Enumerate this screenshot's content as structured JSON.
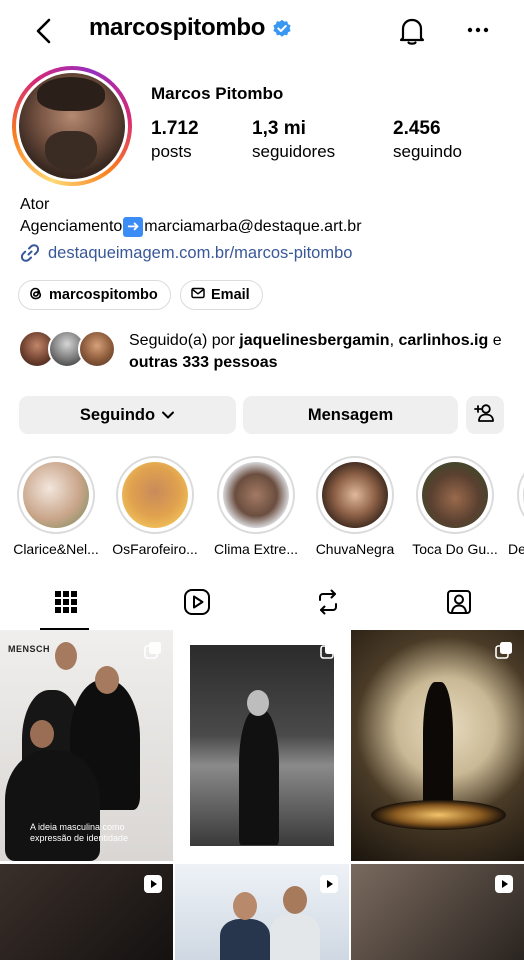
{
  "header": {
    "username": "marcospitombo"
  },
  "profile": {
    "display_name": "Marcos Pitombo",
    "stats": [
      {
        "value": "1.712",
        "label": "posts"
      },
      {
        "value": "1,3 mi",
        "label": "seguidores"
      },
      {
        "value": "2.456",
        "label": "seguindo"
      }
    ],
    "bio": {
      "line1": "Ator",
      "line2_prefix": "Agenciamento",
      "line2_suffix": "marciamarba@destaque.art.br",
      "link": "destaqueimagem.com.br/marcos-pitombo"
    },
    "chips": {
      "threads": "marcospitombo",
      "email": "Email"
    },
    "followed_by": {
      "prefix": "Seguido(a) por ",
      "user1": "jaquelinesbergamin",
      "user2": "carlinhos.ig",
      "connector": " e ",
      "others": "outras 333 pessoas"
    }
  },
  "actions": {
    "following": "Seguindo",
    "message": "Mensagem"
  },
  "highlights": [
    {
      "label": "Clarice&Nel..."
    },
    {
      "label": "OsFarofeiro..."
    },
    {
      "label": "Clima Extre..."
    },
    {
      "label": "ChuvaNegra"
    },
    {
      "label": "Toca Do Gu..."
    },
    {
      "label": "De"
    }
  ],
  "grid": {
    "post1_brand": "MENSCH",
    "post1_caption": "A ideia masculina como\nexpressão de identidade"
  },
  "colors": {
    "verified": "#3897f0",
    "link": "#385898",
    "button_bg": "#efefef"
  }
}
